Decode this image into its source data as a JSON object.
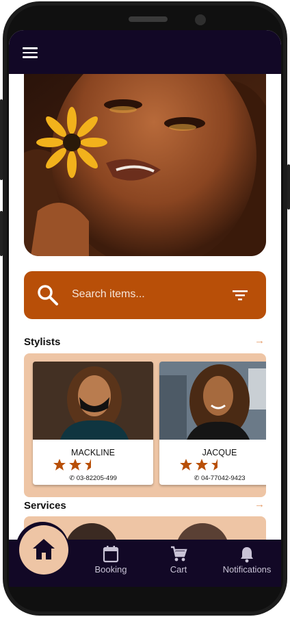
{
  "colors": {
    "appbar": "#120826",
    "accent": "#b84f08",
    "peach": "#eec5a5",
    "star": "#b84f08"
  },
  "appbar": {
    "menu_icon": "menu-icon"
  },
  "search": {
    "placeholder": "Search items..."
  },
  "stylists": {
    "title": "Stylists",
    "items": [
      {
        "name": "MACKLINE",
        "rating": 2.5,
        "phone": "03-82205-499"
      },
      {
        "name": "JACQUE",
        "rating": 2.5,
        "phone": "04-77042-9423"
      }
    ]
  },
  "services": {
    "title": "Services"
  },
  "nav": {
    "home_icon": "home-icon",
    "items": [
      {
        "label": "Booking",
        "icon": "calendar-icon"
      },
      {
        "label": "Cart",
        "icon": "cart-icon"
      },
      {
        "label": "Notifications",
        "icon": "bell-icon"
      }
    ]
  }
}
